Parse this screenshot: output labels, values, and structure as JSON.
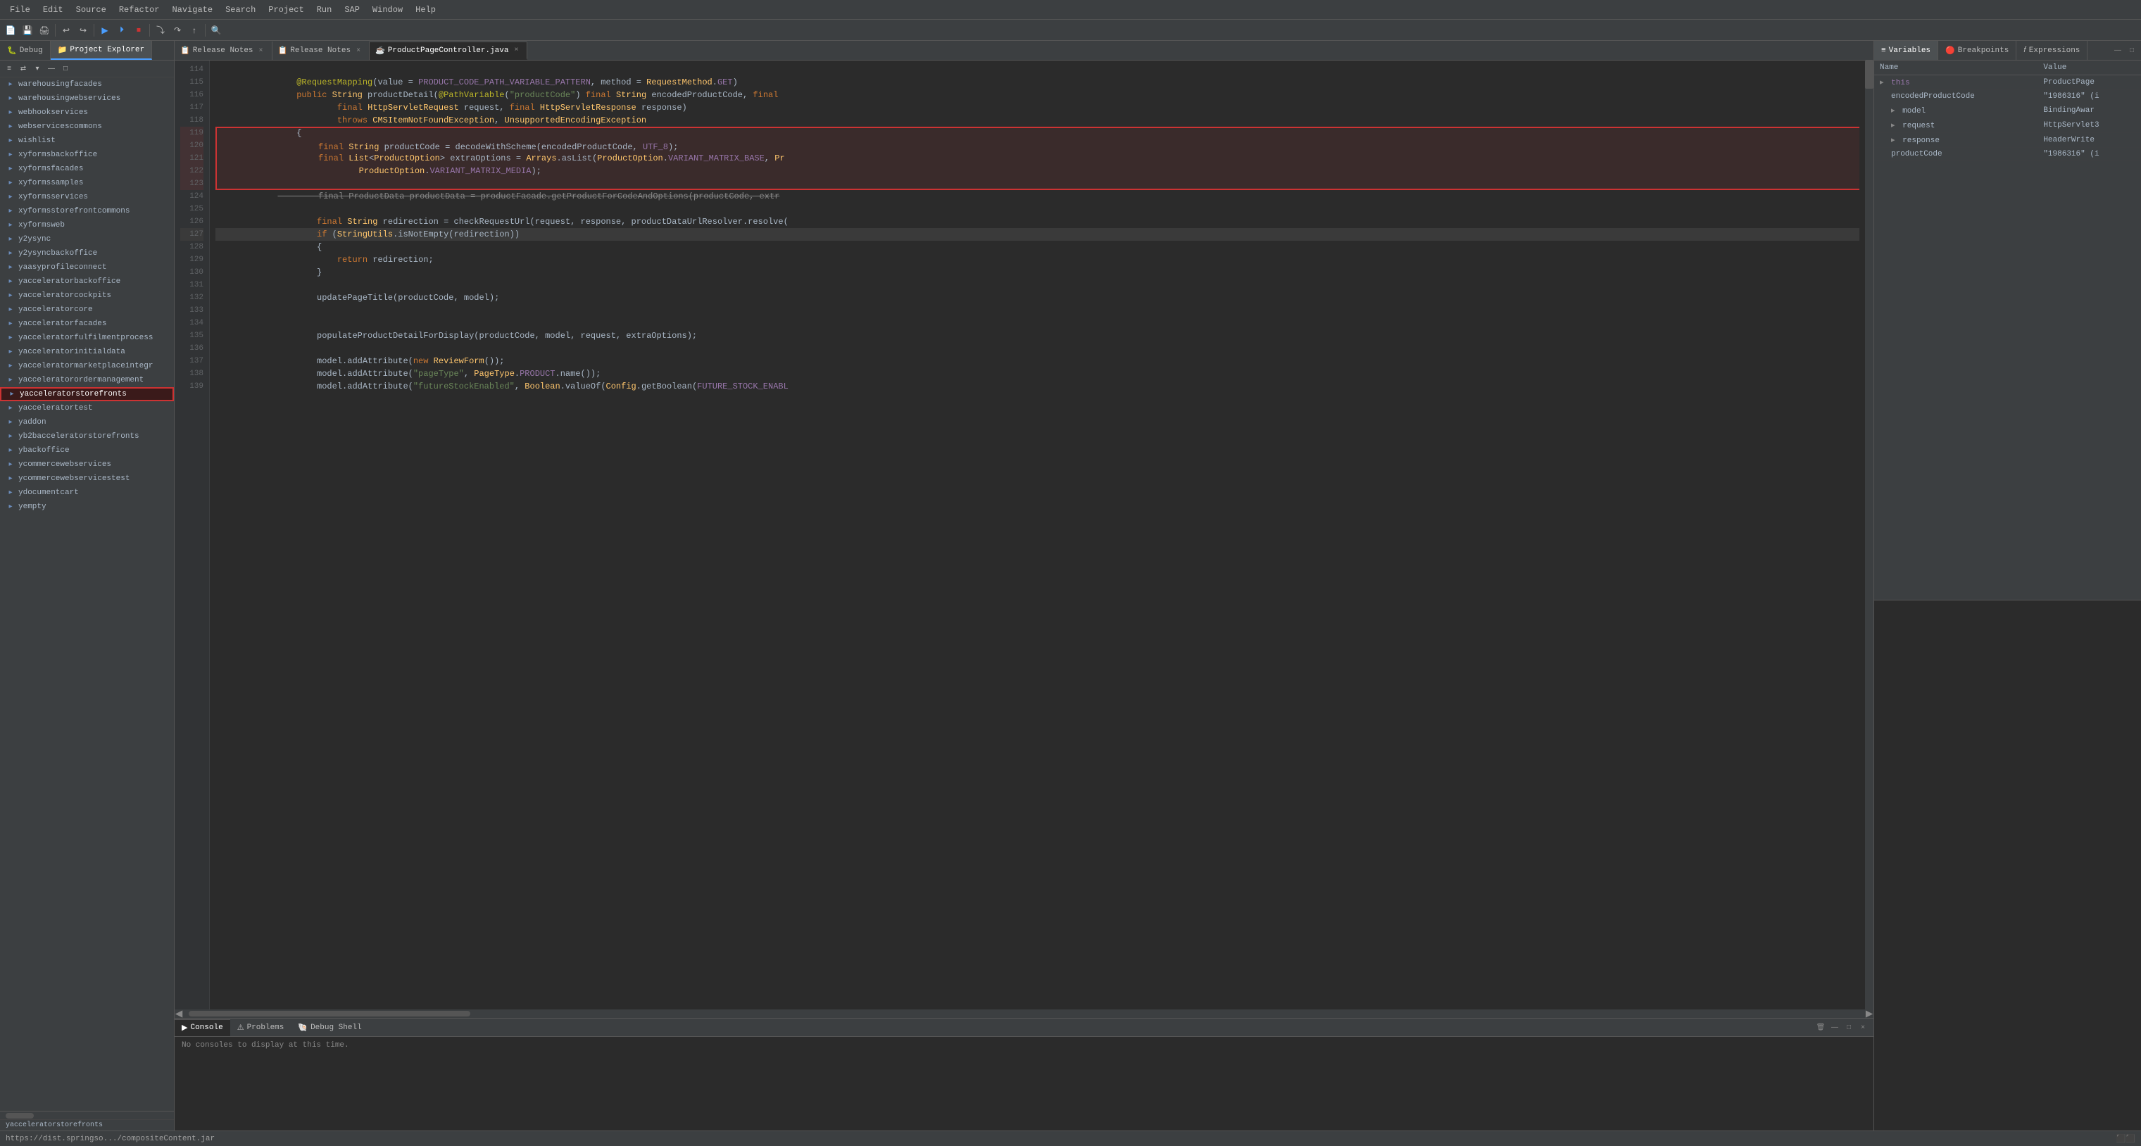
{
  "menubar": {
    "items": [
      "File",
      "Edit",
      "Source",
      "Refactor",
      "Navigate",
      "Search",
      "Project",
      "Run",
      "SAP",
      "Window",
      "Help"
    ]
  },
  "leftPanel": {
    "tabs": [
      {
        "label": "Debug",
        "active": false,
        "icon": "🐛"
      },
      {
        "label": "Project Explorer",
        "active": true,
        "icon": "📁"
      }
    ],
    "treeItems": [
      "warehousingfacades",
      "warehousingwebservices",
      "webhookservices",
      "webservicescommons",
      "wishlist",
      "xyformsbackoffice",
      "xyformsfacades",
      "xyformssamples",
      "xyformsservices",
      "xyformsstorefrontcommons",
      "xyformsweb",
      "y2ysync",
      "y2ysyncbackoffice",
      "yaasyprofileconnect",
      "yacceleratorbackoffice",
      "yacceleratorcockpits",
      "yacceleratorcore",
      "yacceleratorfacades",
      "yacceleratorfulfilmentprocess",
      "yacceleratorinitialdata",
      "yacceleratormarketplaceintegr",
      "yacceleratorordermanagement",
      "yacceleratorstorefronts",
      "yacceleratortest",
      "yaddon",
      "yb2bacceleratorstorefronts",
      "ybackoffice",
      "ycommercewebservices",
      "ycommercewebservicestest",
      "ydocumentcart",
      "yempty"
    ],
    "selectedItem": "yacceleratorstorefronts",
    "bottomLabel": "yacceleratorstorefronts"
  },
  "editorTabs": [
    {
      "label": "Release Notes",
      "active": false,
      "icon": "📄"
    },
    {
      "label": "Release Notes",
      "active": false,
      "icon": "📄"
    },
    {
      "label": "ProductPageController.java",
      "active": true,
      "icon": "☕"
    }
  ],
  "codeLines": [
    {
      "num": 114,
      "content": "    @RequestMapping(value = PRODUCT_CODE_PATH_VARIABLE_PATTERN, method = RequestMethod.GET)"
    },
    {
      "num": 115,
      "content": "    public String productDetail(@PathVariable(\"productCode\") final String encodedProductCode, final"
    },
    {
      "num": 116,
      "content": "            final HttpServletRequest request, final HttpServletResponse response)"
    },
    {
      "num": 117,
      "content": "            throws CMSItemNotFoundException, UnsupportedEncodingException"
    },
    {
      "num": 118,
      "content": "    {"
    },
    {
      "num": 119,
      "content": "        final String productCode = decodeWithScheme(encodedProductCode, UTF_8);",
      "highlighted": true
    },
    {
      "num": 120,
      "content": "        final List<ProductOption> extraOptions = Arrays.asList(ProductOption.VARIANT_MATRIX_BASE, Pr",
      "highlighted": true
    },
    {
      "num": 121,
      "content": "                ProductOption.VARIANT_MATRIX_MEDIA);",
      "highlighted": true
    },
    {
      "num": 122,
      "content": "",
      "highlighted": true
    },
    {
      "num": 123,
      "content": "        final ProductData productData = productFacade.getProductForCodeAndOptions(productCode, extr",
      "highlighted": true
    },
    {
      "num": 124,
      "content": ""
    },
    {
      "num": 125,
      "content": "        final String redirection = checkRequestUrl(request, response, productDataUrlResolver.resolve("
    },
    {
      "num": 126,
      "content": "        if (StringUtils.isNotEmpty(redirection))"
    },
    {
      "num": 127,
      "content": "        {",
      "current": true
    },
    {
      "num": 128,
      "content": "            return redirection;"
    },
    {
      "num": 129,
      "content": "        }"
    },
    {
      "num": 130,
      "content": ""
    },
    {
      "num": 131,
      "content": "        updatePageTitle(productCode, model);"
    },
    {
      "num": 132,
      "content": ""
    },
    {
      "num": 133,
      "content": ""
    },
    {
      "num": 134,
      "content": "        populateProductDetailForDisplay(productCode, model, request, extraOptions);"
    },
    {
      "num": 135,
      "content": ""
    },
    {
      "num": 136,
      "content": "        model.addAttribute(new ReviewForm());"
    },
    {
      "num": 137,
      "content": "        model.addAttribute(\"pageType\", PageType.PRODUCT.name());"
    },
    {
      "num": 138,
      "content": "        model.addAttribute(\"futureStockEnabled\", Boolean.valueOf(Config.getBoolean(FUTURE_STOCK_ENABL"
    },
    {
      "num": 139,
      "content": ""
    }
  ],
  "variables": {
    "headers": [
      "Name",
      "Value"
    ],
    "rows": [
      {
        "name": "this",
        "value": "ProductPage",
        "indent": 0,
        "expandable": true
      },
      {
        "name": "encodedProductCode",
        "value": "\"1986316\" (i",
        "indent": 1,
        "expandable": false
      },
      {
        "name": "model",
        "value": "BindingAwar",
        "indent": 1,
        "expandable": true
      },
      {
        "name": "request",
        "value": "HttpServlet3",
        "indent": 1,
        "expandable": true
      },
      {
        "name": "response",
        "value": "HeaderWrite",
        "indent": 1,
        "expandable": true
      },
      {
        "name": "productCode",
        "value": "\"1986316\" (i",
        "indent": 1,
        "expandable": false
      }
    ]
  },
  "consoleTabs": [
    {
      "label": "Console",
      "active": true
    },
    {
      "label": "Problems",
      "active": false
    },
    {
      "label": "Debug Shell",
      "active": false
    }
  ],
  "consoleContent": "No consoles to display at this time.",
  "statusBar": {
    "left": "https://dist.springso.../compositeContent.jar",
    "right": "⬛⬛"
  }
}
